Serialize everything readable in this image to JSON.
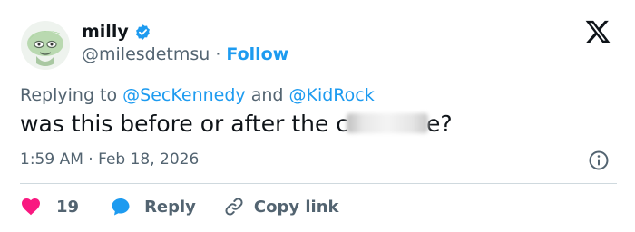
{
  "author": {
    "display_name": "milly",
    "handle": "@milesdetmsu",
    "separator": "·",
    "follow_label": "Follow"
  },
  "replying": {
    "prefix": "Replying to",
    "mention1": "@SecKennedy",
    "conj": "and",
    "mention2": "@KidRock"
  },
  "tweet": {
    "text_before": "was this before or after the c",
    "text_after": "e?"
  },
  "meta": {
    "time": "1:59 AM",
    "separator": "·",
    "date": "Feb 18, 2026"
  },
  "actions": {
    "like_count": "19",
    "reply_label": "Reply",
    "copy_label": "Copy link"
  },
  "colors": {
    "accent": "#1d9bf0",
    "like": "#f91880",
    "text": "#0f1419",
    "secondary": "#536471"
  },
  "icons": {
    "avatar": "cartoon-avatar",
    "verified": "verified-badge-icon",
    "logo": "x-logo-icon",
    "info": "info-icon",
    "like": "heart-icon",
    "reply": "reply-bubble-icon",
    "copy": "link-icon"
  }
}
